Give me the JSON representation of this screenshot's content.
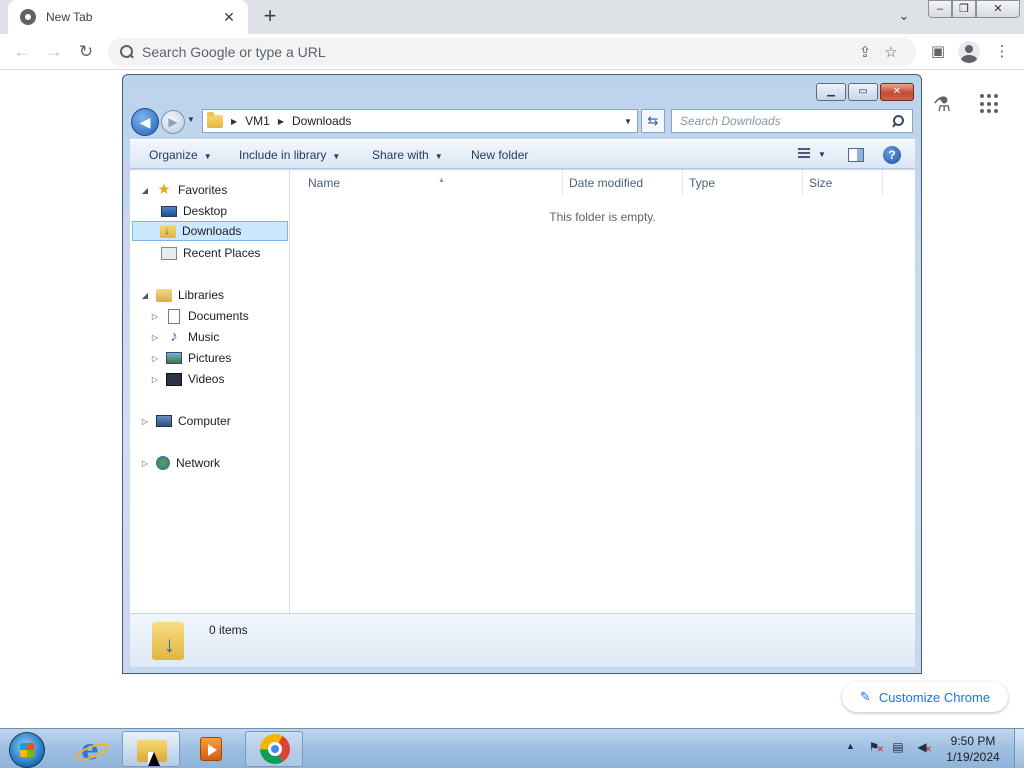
{
  "chrome": {
    "tab_title": "New Tab",
    "tab_close": "✕",
    "new_tab": "+",
    "tab_search": "⌄",
    "win_min": "‒",
    "win_max": "❐",
    "win_close": "✕",
    "omnibox_placeholder": "Search Google or type a URL",
    "back": "←",
    "forward": "→",
    "reload": "↻",
    "share": "⇪",
    "bookmark": "☆",
    "side_panel": "▣",
    "menu": "⋮",
    "labs": "⚗",
    "customize_label": "Customize Chrome",
    "pencil": "✎"
  },
  "explorer": {
    "breadcrumb": [
      "VM1",
      "Downloads"
    ],
    "search_placeholder": "Search Downloads",
    "commands": {
      "organize": "Organize",
      "include_in_library": "Include in library",
      "share_with": "Share with",
      "new_folder": "New folder"
    },
    "nav": {
      "favorites": "Favorites",
      "desktop": "Desktop",
      "downloads": "Downloads",
      "recent_places": "Recent Places",
      "libraries": "Libraries",
      "documents": "Documents",
      "music": "Music",
      "pictures": "Pictures",
      "videos": "Videos",
      "computer": "Computer",
      "network": "Network"
    },
    "columns": {
      "name": "Name",
      "date_modified": "Date modified",
      "type": "Type",
      "size": "Size"
    },
    "empty_message": "This folder is empty.",
    "item_count": "0 items"
  },
  "taskbar": {
    "time": "9:50 PM",
    "date": "1/19/2024"
  }
}
